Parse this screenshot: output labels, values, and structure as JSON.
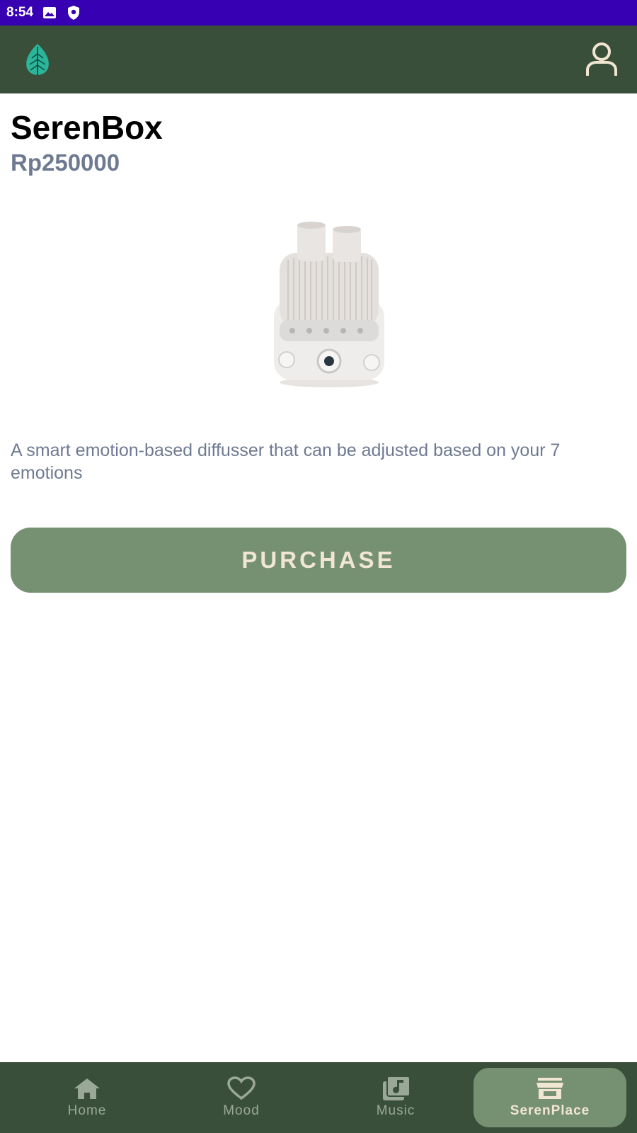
{
  "status_bar": {
    "time": "8:54",
    "icons": [
      "image-icon",
      "shield-icon"
    ]
  },
  "app_bar": {
    "logo_icon": "leaf-icon",
    "profile_icon": "person-icon"
  },
  "product": {
    "title": "SerenBox",
    "price": "Rp250000",
    "description": "A smart emotion-based diffusser that can be adjusted based on your 7 emotions",
    "image": "diffuser-product-image"
  },
  "purchase": {
    "label": "PURCHASE"
  },
  "bottom_nav": {
    "items": [
      {
        "label": "Home",
        "icon": "home-icon",
        "active": false
      },
      {
        "label": "Mood",
        "icon": "heart-icon",
        "active": false
      },
      {
        "label": "Music",
        "icon": "music-library-icon",
        "active": false
      },
      {
        "label": "SerenPlace",
        "icon": "store-icon",
        "active": true
      }
    ]
  },
  "colors": {
    "status_bar": "#3700b3",
    "app_bar": "#3a4f3a",
    "accent_green": "#769171",
    "price_text": "#6e7a91",
    "cream_text": "#f1e6d2"
  }
}
